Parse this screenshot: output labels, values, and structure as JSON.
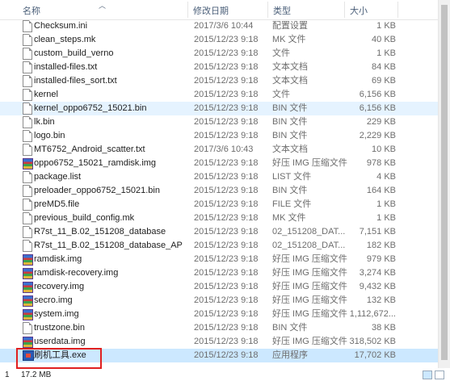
{
  "header": {
    "name": "名称",
    "date": "修改日期",
    "type": "类型",
    "size": "大小"
  },
  "files": [
    {
      "name": "Checksum.ini",
      "date": "2017/3/6 10:44",
      "type": "配置设置",
      "size": "1 KB",
      "icon": "text-file-icon"
    },
    {
      "name": "clean_steps.mk",
      "date": "2015/12/23 9:18",
      "type": "MK 文件",
      "size": "40 KB",
      "icon": "text-file-icon"
    },
    {
      "name": "custom_build_verno",
      "date": "2015/12/23 9:18",
      "type": "文件",
      "size": "1 KB",
      "icon": "text-file-icon"
    },
    {
      "name": "installed-files.txt",
      "date": "2015/12/23 9:18",
      "type": "文本文档",
      "size": "84 KB",
      "icon": "text-file-icon"
    },
    {
      "name": "installed-files_sort.txt",
      "date": "2015/12/23 9:18",
      "type": "文本文档",
      "size": "69 KB",
      "icon": "text-file-icon"
    },
    {
      "name": "kernel",
      "date": "2015/12/23 9:18",
      "type": "文件",
      "size": "6,156 KB",
      "icon": "text-file-icon"
    },
    {
      "name": "kernel_oppo6752_15021.bin",
      "date": "2015/12/23 9:18",
      "type": "BIN 文件",
      "size": "6,156 KB",
      "icon": "text-file-icon"
    },
    {
      "name": "lk.bin",
      "date": "2015/12/23 9:18",
      "type": "BIN 文件",
      "size": "229 KB",
      "icon": "text-file-icon"
    },
    {
      "name": "logo.bin",
      "date": "2015/12/23 9:18",
      "type": "BIN 文件",
      "size": "2,229 KB",
      "icon": "text-file-icon"
    },
    {
      "name": "MT6752_Android_scatter.txt",
      "date": "2017/3/6 10:43",
      "type": "文本文档",
      "size": "10 KB",
      "icon": "text-file-icon"
    },
    {
      "name": "oppo6752_15021_ramdisk.img",
      "date": "2015/12/23 9:18",
      "type": "好压 IMG 压缩文件",
      "size": "978 KB",
      "icon": "archive-file-icon"
    },
    {
      "name": "package.list",
      "date": "2015/12/23 9:18",
      "type": "LIST 文件",
      "size": "4 KB",
      "icon": "text-file-icon"
    },
    {
      "name": "preloader_oppo6752_15021.bin",
      "date": "2015/12/23 9:18",
      "type": "BIN 文件",
      "size": "164 KB",
      "icon": "text-file-icon"
    },
    {
      "name": "preMD5.file",
      "date": "2015/12/23 9:18",
      "type": "FILE 文件",
      "size": "1 KB",
      "icon": "text-file-icon"
    },
    {
      "name": "previous_build_config.mk",
      "date": "2015/12/23 9:18",
      "type": "MK 文件",
      "size": "1 KB",
      "icon": "text-file-icon"
    },
    {
      "name": "R7st_11_B.02_151208_database",
      "date": "2015/12/23 9:18",
      "type": "02_151208_DAT...",
      "size": "7,151 KB",
      "icon": "text-file-icon"
    },
    {
      "name": "R7st_11_B.02_151208_database_AP",
      "date": "2015/12/23 9:18",
      "type": "02_151208_DAT...",
      "size": "182 KB",
      "icon": "text-file-icon"
    },
    {
      "name": "ramdisk.img",
      "date": "2015/12/23 9:18",
      "type": "好压 IMG 压缩文件",
      "size": "979 KB",
      "icon": "archive-file-icon"
    },
    {
      "name": "ramdisk-recovery.img",
      "date": "2015/12/23 9:18",
      "type": "好压 IMG 压缩文件",
      "size": "3,274 KB",
      "icon": "archive-file-icon"
    },
    {
      "name": "recovery.img",
      "date": "2015/12/23 9:18",
      "type": "好压 IMG 压缩文件",
      "size": "9,432 KB",
      "icon": "archive-file-icon"
    },
    {
      "name": "secro.img",
      "date": "2015/12/23 9:18",
      "type": "好压 IMG 压缩文件",
      "size": "132 KB",
      "icon": "archive-file-icon"
    },
    {
      "name": "system.img",
      "date": "2015/12/23 9:18",
      "type": "好压 IMG 压缩文件",
      "size": "1,112,672...",
      "icon": "archive-file-icon"
    },
    {
      "name": "trustzone.bin",
      "date": "2015/12/23 9:18",
      "type": "BIN 文件",
      "size": "38 KB",
      "icon": "text-file-icon"
    },
    {
      "name": "userdata.img",
      "date": "2015/12/23 9:18",
      "type": "好压 IMG 压缩文件",
      "size": "318,502 KB",
      "icon": "archive-file-icon"
    },
    {
      "name": "刷机工具.exe",
      "date": "2015/12/23 9:18",
      "type": "应用程序",
      "size": "17,702 KB",
      "icon": "exe-app-icon"
    }
  ],
  "status": {
    "count": "1",
    "selected_size": "17.2 MB"
  },
  "colors": {
    "selected_row": "#cce8ff",
    "hover_row": "#e5f3ff",
    "highlight_box": "#e02020"
  }
}
